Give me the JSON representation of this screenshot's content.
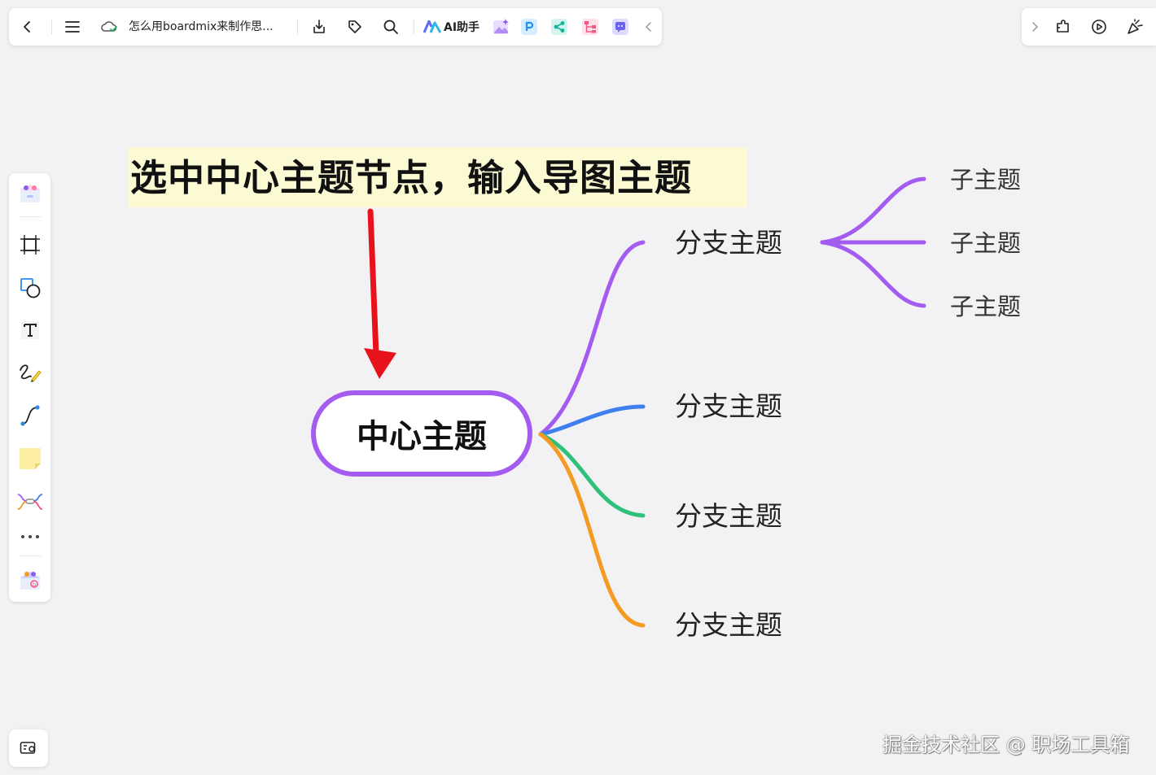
{
  "toolbar": {
    "document_title": "怎么用boardmix来制作思...",
    "ai_assistant_label": "AI助手"
  },
  "annotation": {
    "text": "选中中心主题节点，输入导图主题",
    "highlight_color": "#fcfad2",
    "arrow_color": "#e8121c"
  },
  "mindmap": {
    "central_topic": "中心主题",
    "branches": [
      {
        "label": "分支主题",
        "color": "#a45cf0",
        "subtopics": [
          "子主题",
          "子主题",
          "子主题"
        ]
      },
      {
        "label": "分支主题",
        "color": "#3f7ff0"
      },
      {
        "label": "分支主题",
        "color": "#2fc07c"
      },
      {
        "label": "分支主题",
        "color": "#f59a23"
      }
    ]
  },
  "watermark": "掘金技术社区 @ 职场工具箱"
}
